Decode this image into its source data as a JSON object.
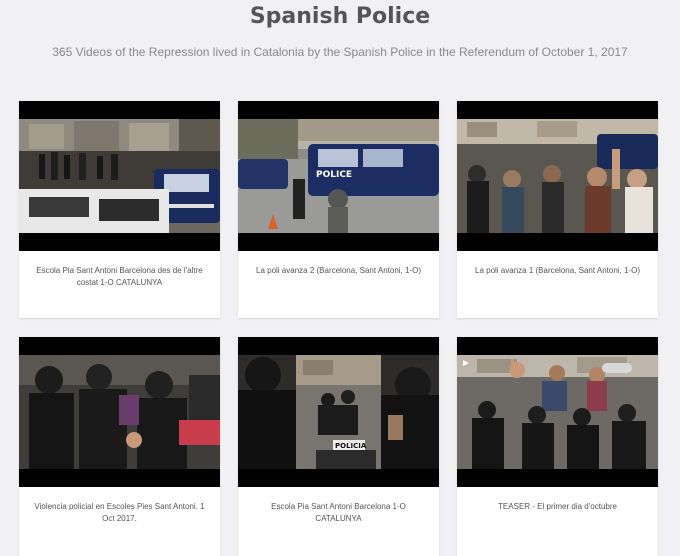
{
  "header": {
    "title": "Spanish Police",
    "subtitle": "365 Videos of the Repression lived in Catalonia by the Spanish Police in the Referendum of October 1, 2017"
  },
  "videos": [
    {
      "caption": "Escola Pia Sant Antoni Barcelona des de l'altre costat 1-O CATALUNYA",
      "thumbnail_icon": "police-van-thumbnail"
    },
    {
      "caption": "La poli avanza 2 (Barcelona, Sant Antoni, 1-O)",
      "thumbnail_icon": "police-van-thumbnail",
      "van_text": "POLICE"
    },
    {
      "caption": "La poli avanza 1 (Barcelona, Sant Antoni, 1-O)",
      "thumbnail_icon": "crowd-thumbnail"
    },
    {
      "caption": "Violencia policial en Escoles Pies Sant Antoni. 1 Oct 2017.",
      "thumbnail_icon": "riot-police-thumbnail"
    },
    {
      "caption": "Escola Pia Sant Antoni Barcelona 1-O CATALUNYA",
      "thumbnail_icon": "riot-police-thumbnail",
      "badge_text": "POLICIA"
    },
    {
      "caption": "TEASER - El primer dia d'octubre",
      "thumbnail_icon": "crowd-thumbnail"
    }
  ],
  "colors": {
    "background": "#f1f1f4",
    "title": "#555557",
    "subtitle": "#8a8a8e",
    "card": "#ffffff"
  }
}
